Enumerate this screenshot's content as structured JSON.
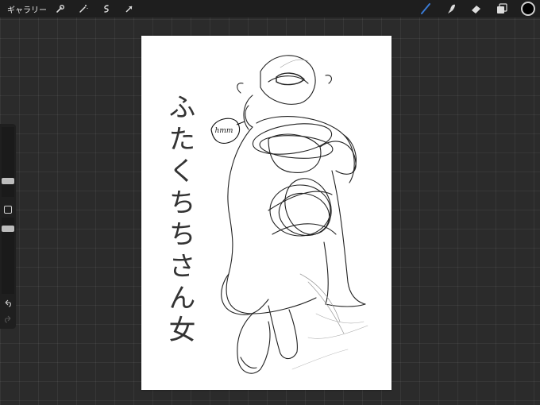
{
  "topbar": {
    "gallery_label": "ギャラリー",
    "left_tools": [
      "wrench-icon",
      "magic-wand-icon",
      "selection-icon",
      "transform-arrow-icon"
    ],
    "right_tools": [
      "brush-icon",
      "smudge-icon",
      "eraser-icon",
      "layers-icon"
    ],
    "active_color": "#000000",
    "accent_color": "#3a7bd5"
  },
  "canvas": {
    "vertical_text": "ふたくちちさん女",
    "speech_bubble_text": "hmm"
  },
  "sidebar": {
    "size_level": 0.28,
    "opacity_level": 0.5
  }
}
